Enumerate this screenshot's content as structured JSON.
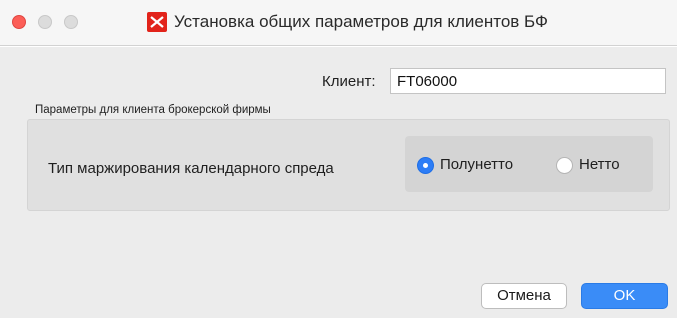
{
  "window": {
    "title": "Установка общих параметров для клиентов БФ",
    "logo_icon": "moex-logo-icon",
    "logo_color": "#e2231a"
  },
  "client": {
    "label": "Клиент:",
    "value": "FT06000"
  },
  "group": {
    "title": "Параметры для клиента брокерской фирмы",
    "param_label": "Тип маржирования календарного спреда",
    "options": [
      {
        "label": "Полунетто",
        "selected": true
      },
      {
        "label": "Нетто",
        "selected": false
      }
    ]
  },
  "buttons": {
    "cancel": "Отмена",
    "ok": "OK"
  },
  "colors": {
    "close_button": "#fc5e57",
    "accent": "#3a8cf7"
  }
}
